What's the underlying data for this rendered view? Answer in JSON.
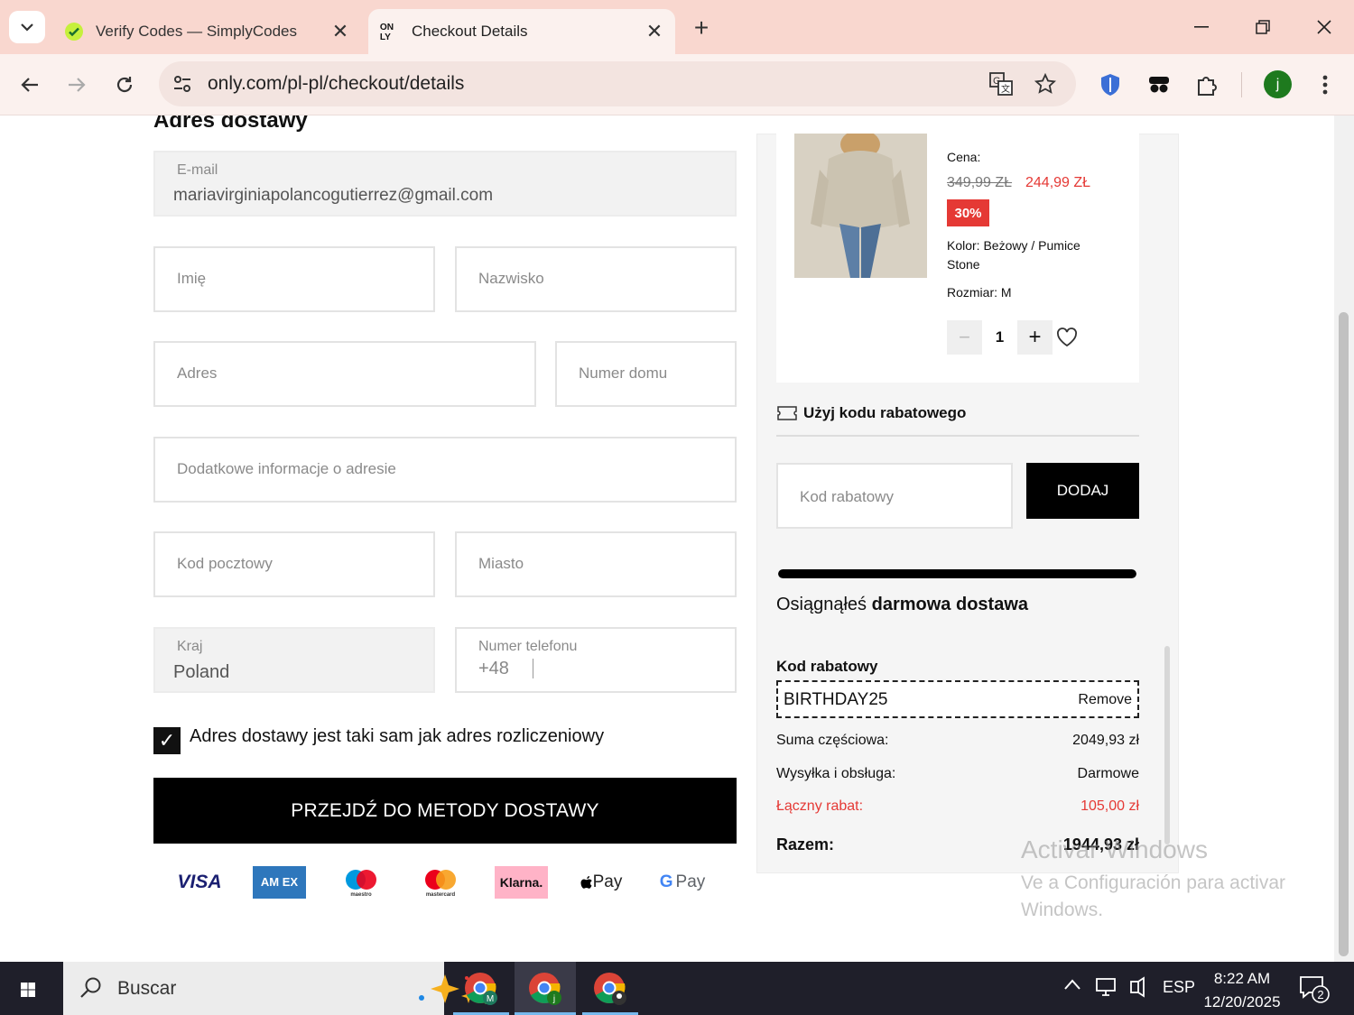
{
  "browser": {
    "tabs": [
      {
        "title": "Verify Codes — SimplyCodes",
        "active": false,
        "favicon": "simplycodes-icon"
      },
      {
        "title": "Checkout Details",
        "active": true,
        "favicon": "only-logo-icon"
      }
    ],
    "favicon_text": "ON\nLY",
    "url": "only.com/pl-pl/checkout/details",
    "profile_initial": "j"
  },
  "form": {
    "heading": "Adres dostawy",
    "email_label": "E-mail",
    "email_value": "mariavirginiapolancogutierrez@gmail.com",
    "first_name_placeholder": "Imię",
    "last_name_placeholder": "Nazwisko",
    "address_placeholder": "Adres",
    "house_number_placeholder": "Numer domu",
    "additional_info_placeholder": "Dodatkowe informacje o adresie",
    "postal_code_placeholder": "Kod pocztowy",
    "city_placeholder": "Miasto",
    "country_label": "Kraj",
    "country_value": "Poland",
    "phone_label": "Numer telefonu",
    "phone_prefix": "+48",
    "same_billing_label": "Adres dostawy jest taki sam jak adres rozliczeniowy",
    "same_billing_checked": true,
    "submit_label": "PRZEJDŹ DO METODY DOSTAWY"
  },
  "payment_methods": [
    {
      "name": "VISA",
      "color": "#1a1f71"
    },
    {
      "name": "AM EX",
      "color": "#2e77bc"
    },
    {
      "name": "maestro",
      "color": "#0099df"
    },
    {
      "name": "mastercard",
      "color": "#eb001b"
    },
    {
      "name": "Klarna.",
      "color": "#ffb3c7"
    },
    {
      "name": "Pay",
      "color": "#000000"
    },
    {
      "name": "Pay",
      "color": "#5f6368"
    }
  ],
  "product": {
    "price_label": "Cena:",
    "price_old": "349,99 ZŁ",
    "price_new": "244,99 ZŁ",
    "discount_badge": "30%",
    "color_line1": "Kolor: Beżowy / Pumice",
    "color_line2": "Stone",
    "size": "Rozmiar: M",
    "quantity": "1",
    "minus": "−",
    "plus": "+"
  },
  "summary": {
    "coupon_heading": "Użyj kodu rabatowego",
    "coupon_placeholder": "Kod rabatowy",
    "add_button": "DODAJ",
    "free_shipping_progress": 1.0,
    "free_shipping_prefix": "Osiągnąłeś ",
    "free_shipping_bold": "darmowa dostawa",
    "code_title": "Kod rabatowy",
    "applied_code": "BIRTHDAY25",
    "remove_label": "Remove",
    "subtotal_label": "Suma częściowa:",
    "subtotal_value": "2049,93 zł",
    "shipping_label": "Wysyłka i obsługa:",
    "shipping_value": "Darmowe",
    "discount_label": "Łączny rabat:",
    "discount_value": "105,00 zł",
    "total_label": "Razem:",
    "total_value": "1944,93 zł"
  },
  "watermark": {
    "line1": "Activar Windows",
    "line2": "Ve a Configuración para activar",
    "line3": "Windows."
  },
  "taskbar": {
    "search_text": "Buscar",
    "lang": "ESP",
    "time": "8:22 AM",
    "date": "12/20/2025",
    "notifications": "2",
    "app_badges": [
      "M",
      "j",
      ""
    ]
  },
  "colors": {
    "accent_red": "#e53935",
    "tabbar_bg": "#f9d7cf",
    "toolbar_bg": "#fbf1ee"
  }
}
